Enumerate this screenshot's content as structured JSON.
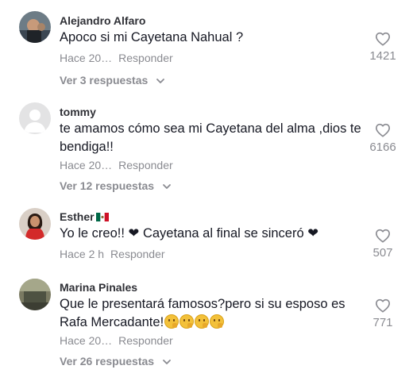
{
  "comments": [
    {
      "username": "Alejandro Alfaro",
      "text": "Apoco si mi Cayetana Nahual ?",
      "time": "Hace 20…",
      "reply_label": "Responder",
      "likes": "1421",
      "view_replies": "Ver 3 respuestas",
      "avatar": "photo"
    },
    {
      "username": "tommy",
      "text": "te amamos cómo sea mi Cayetana del alma ,dios te bendiga!!",
      "time": "Hace 20…",
      "reply_label": "Responder",
      "likes": "6166",
      "view_replies": "Ver 12 respuestas",
      "avatar": "default-user"
    },
    {
      "username": "Esther",
      "username_flag": "mexico-flag-icon",
      "text": "Yo le creo!! ❤ Cayetana al final se sinceró ❤",
      "time": "Hace 2 h",
      "reply_label": "Responder",
      "likes": "507",
      "avatar": "photo"
    },
    {
      "username": "Marina Pinales",
      "text": "Que le presentará famosos?pero si su esposo es Rafa Mercadante!",
      "text_emojis": [
        "thinking-face",
        "thinking-face",
        "thinking-face",
        "thinking-face"
      ],
      "time": "Hace 20…",
      "reply_label": "Responder",
      "likes": "771",
      "view_replies": "Ver 26 respuestas",
      "avatar": "photo"
    }
  ],
  "icons": {
    "like": "heart-outline-icon",
    "expand": "chevron-down-icon"
  },
  "colors": {
    "primary_text": "#161823",
    "secondary_text": "#8a8b91",
    "username": "#2f3036",
    "icon": "#8a8b91"
  }
}
